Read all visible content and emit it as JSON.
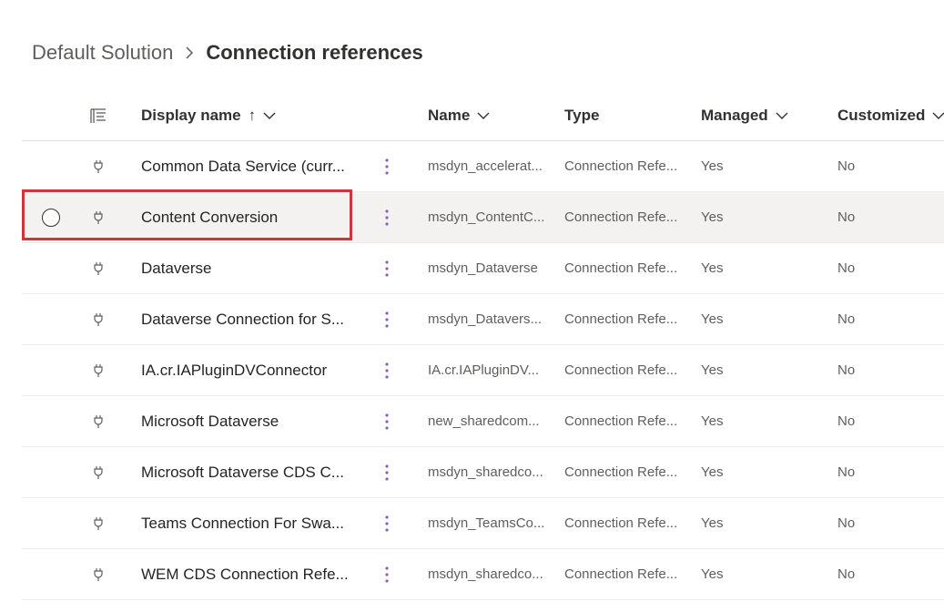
{
  "breadcrumb": {
    "parent": "Default Solution",
    "current": "Connection references"
  },
  "columns": {
    "display_name": "Display name",
    "display_name_sort": "↑",
    "name": "Name",
    "type": "Type",
    "managed": "Managed",
    "customized": "Customized"
  },
  "rows": [
    {
      "display_name": "Common Data Service (curr...",
      "name": "msdyn_accelerat...",
      "type": "Connection Refe...",
      "managed": "Yes",
      "customized": "No"
    },
    {
      "display_name": "Content Conversion",
      "name": "msdyn_ContentC...",
      "type": "Connection Refe...",
      "managed": "Yes",
      "customized": "No"
    },
    {
      "display_name": "Dataverse",
      "name": "msdyn_Dataverse",
      "type": "Connection Refe...",
      "managed": "Yes",
      "customized": "No"
    },
    {
      "display_name": "Dataverse Connection for S...",
      "name": "msdyn_Datavers...",
      "type": "Connection Refe...",
      "managed": "Yes",
      "customized": "No"
    },
    {
      "display_name": "IA.cr.IAPluginDVConnector",
      "name": "IA.cr.IAPluginDV...",
      "type": "Connection Refe...",
      "managed": "Yes",
      "customized": "No"
    },
    {
      "display_name": "Microsoft Dataverse",
      "name": "new_sharedcom...",
      "type": "Connection Refe...",
      "managed": "Yes",
      "customized": "No"
    },
    {
      "display_name": "Microsoft Dataverse CDS C...",
      "name": "msdyn_sharedco...",
      "type": "Connection Refe...",
      "managed": "Yes",
      "customized": "No"
    },
    {
      "display_name": "Teams Connection For Swa...",
      "name": "msdyn_TeamsCo...",
      "type": "Connection Refe...",
      "managed": "Yes",
      "customized": "No"
    },
    {
      "display_name": "WEM CDS Connection Refe...",
      "name": "msdyn_sharedco...",
      "type": "Connection Refe...",
      "managed": "Yes",
      "customized": "No"
    }
  ],
  "selected_row": 1,
  "icons": {
    "column_options": "column-options-icon",
    "row_type": "plug-icon",
    "row_more": "more-vertical-icon",
    "header_menu": "chevron-down-icon",
    "breadcrumb_separator": "chevron-right-icon"
  },
  "colors": {
    "highlight_border": "#d13438",
    "selected_row_bg": "#f3f2f1",
    "more_icon": "#8764b8"
  }
}
